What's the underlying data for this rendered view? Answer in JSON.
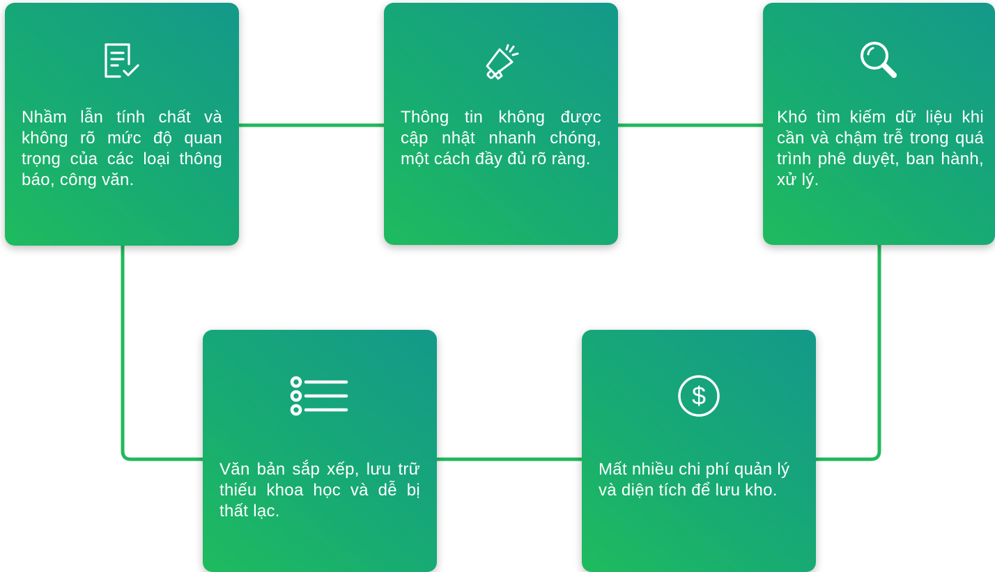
{
  "colors": {
    "connector": "#22b85c",
    "card_start": "#1fbb5e",
    "card_end": "#14998a",
    "text": "#ffffff"
  },
  "cards": [
    {
      "icon": "document-check-icon",
      "text": "Nhầm lẫn tính chất và không rõ mức độ quan trọng của các loại thông báo, công văn."
    },
    {
      "icon": "megaphone-icon",
      "text": "Thông tin không được cập nhật nhanh chóng, một cách đầy đủ rõ ràng."
    },
    {
      "icon": "search-icon",
      "text": "Khó tìm kiếm dữ liệu khi cần và chậm trễ trong quá trình phê duyệt, ban hành, xử lý."
    },
    {
      "icon": "list-icon",
      "text": "Văn bản sắp xếp, lưu trữ thiếu khoa học và dễ bị thất lạc."
    },
    {
      "icon": "dollar-circle-icon",
      "text": "Mất nhiều chi phí quản lý và diện tích để lưu kho."
    }
  ]
}
